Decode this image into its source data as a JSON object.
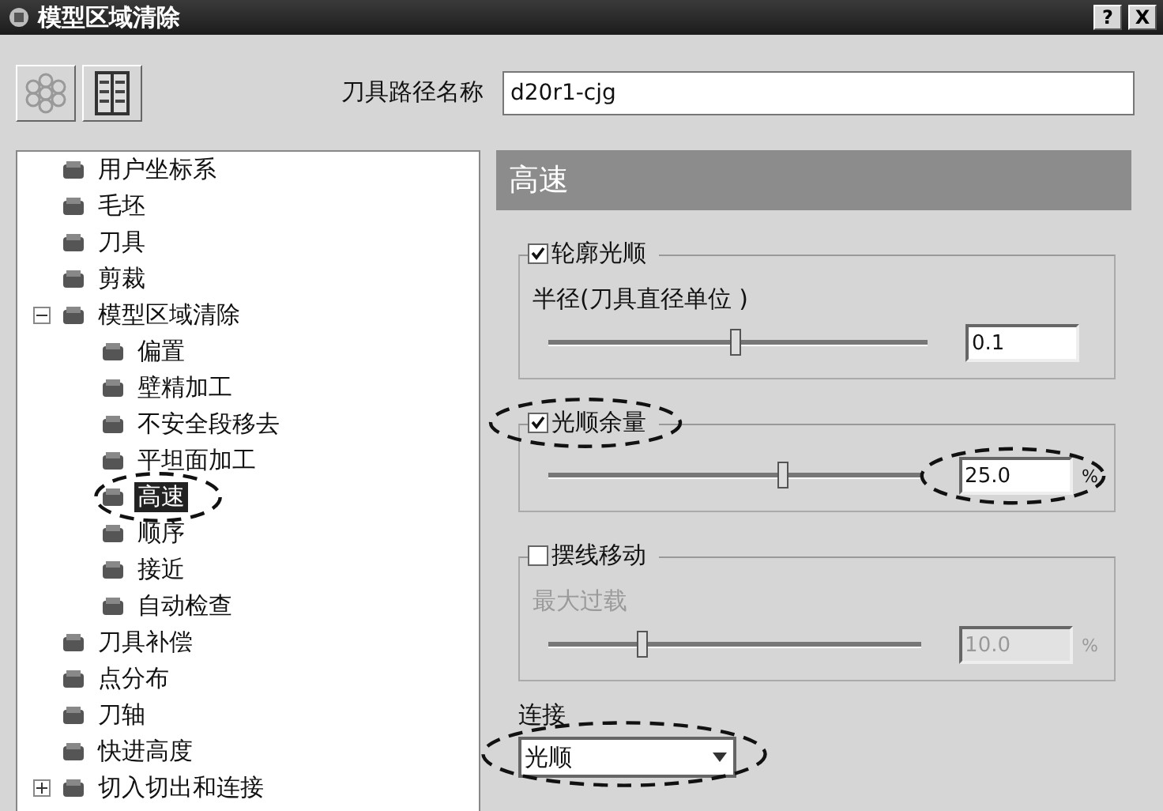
{
  "window": {
    "title": "模型区域清除",
    "help_button": "?",
    "close_button": "X"
  },
  "toolpath_name": {
    "label": "刀具路径名称",
    "value": "d20r1-cjg"
  },
  "tree": [
    {
      "label": "用户坐标系",
      "selected": false,
      "highlighted": false
    },
    {
      "label": "毛坯",
      "selected": false,
      "highlighted": false
    },
    {
      "label": "刀具",
      "selected": false,
      "highlighted": false
    },
    {
      "label": "剪裁",
      "selected": false,
      "highlighted": false
    },
    {
      "label": "模型区域清除",
      "selected": false,
      "highlighted": false,
      "expanded": true,
      "children": [
        {
          "label": "偏置",
          "selected": false,
          "highlighted": false
        },
        {
          "label": "壁精加工",
          "selected": false,
          "highlighted": false
        },
        {
          "label": "不安全段移去",
          "selected": false,
          "highlighted": false
        },
        {
          "label": "平坦面加工",
          "selected": false,
          "highlighted": false
        },
        {
          "label": "高速",
          "selected": true,
          "highlighted": true
        },
        {
          "label": "顺序",
          "selected": false,
          "highlighted": false
        },
        {
          "label": "接近",
          "selected": false,
          "highlighted": false
        },
        {
          "label": "自动检查",
          "selected": false,
          "highlighted": false
        }
      ]
    },
    {
      "label": "刀具补偿",
      "selected": false,
      "highlighted": false
    },
    {
      "label": "点分布",
      "selected": false,
      "highlighted": false
    },
    {
      "label": "刀轴",
      "selected": false,
      "highlighted": false
    },
    {
      "label": "快进高度",
      "selected": false,
      "highlighted": false
    },
    {
      "label": "切入切出和连接",
      "selected": false,
      "highlighted": false,
      "expanded": false
    }
  ],
  "panel": {
    "title": "高速",
    "groups": [
      {
        "label": "轮廓光顺",
        "checked": true,
        "disabled": false,
        "label_highlighted": false,
        "field_label": "半径(刀具直径单位 )",
        "level": 0.49,
        "value": "0.1",
        "value_highlighted": false
      },
      {
        "label": "光顺余量",
        "checked": true,
        "disabled": false,
        "label_highlighted": true,
        "level": 0.63,
        "value": "25.0",
        "unit": "%",
        "value_highlighted": true
      },
      {
        "label": "摆线移动",
        "checked": false,
        "disabled": true,
        "label_highlighted": false,
        "field_label": "最大过载",
        "level": 0.25,
        "value": "10.0",
        "unit": "%",
        "value_highlighted": false
      }
    ],
    "connection": {
      "label": "连接",
      "value": "光顺",
      "highlighted": true
    }
  }
}
